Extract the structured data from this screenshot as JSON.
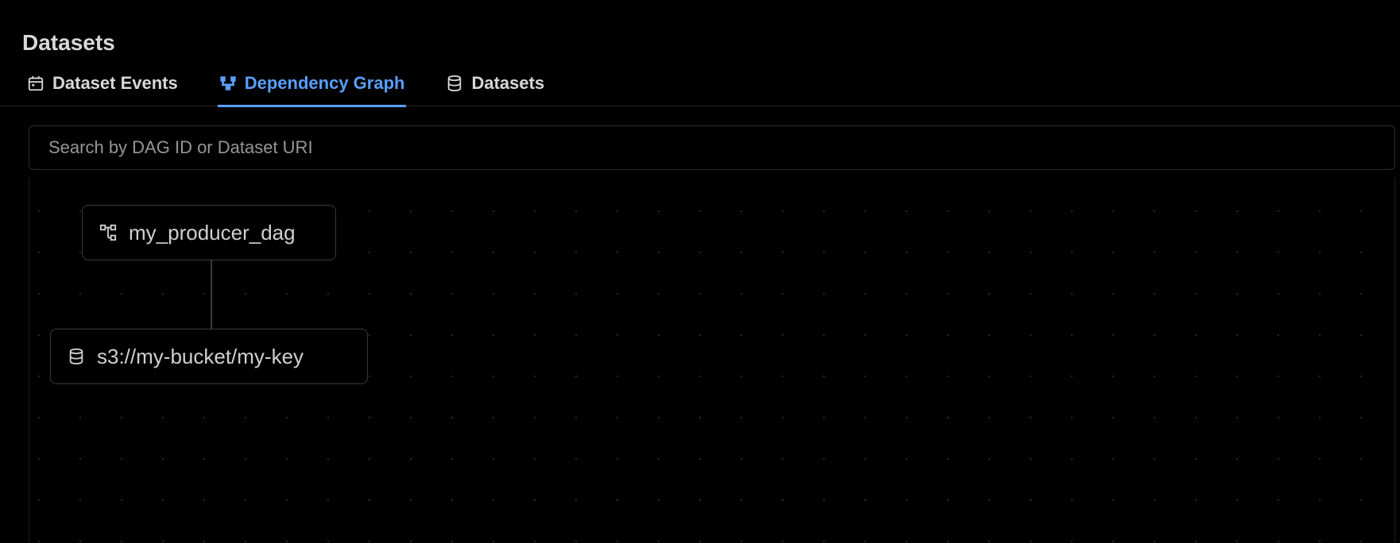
{
  "header": {
    "title": "Datasets"
  },
  "tabs": {
    "dataset_events": "Dataset Events",
    "dependency_graph": "Dependency Graph",
    "datasets": "Datasets"
  },
  "search": {
    "placeholder": "Search by DAG ID or Dataset URI",
    "value": ""
  },
  "graph": {
    "nodes": {
      "producer": "my_producer_dag",
      "dataset": "s3://my-bucket/my-key"
    }
  }
}
